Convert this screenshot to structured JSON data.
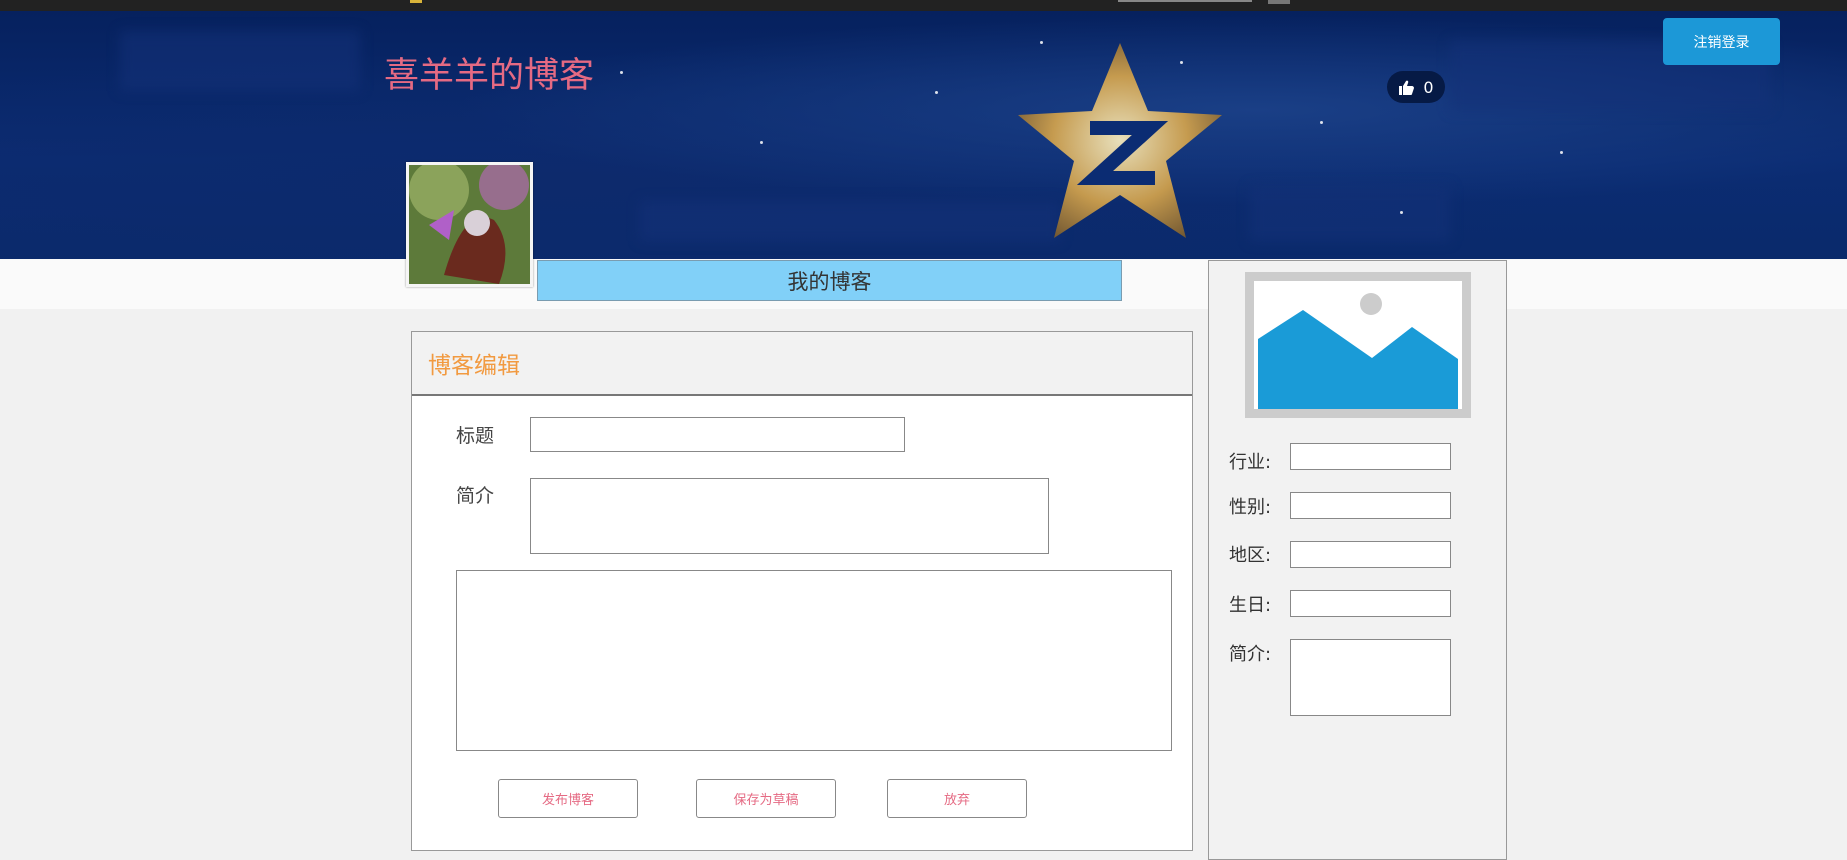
{
  "header": {
    "site_title": "喜羊羊的博客",
    "logout_label": "注销登录",
    "like_count": "0",
    "like_icon": "thumbs-up-icon",
    "my_blog_tab": "我的博客"
  },
  "editor": {
    "heading": "博客编辑",
    "title_label": "标题",
    "title_value": "",
    "summary_label": "简介",
    "summary_value": "",
    "content_value": "",
    "buttons": {
      "publish": "发布博客",
      "save_draft": "保存为草稿",
      "discard": "放弃"
    }
  },
  "profile": {
    "image_icon": "image-placeholder-icon",
    "industry_label": "行业:",
    "industry_value": "",
    "gender_label": "性别:",
    "gender_value": "",
    "region_label": "地区:",
    "region_value": "",
    "birthday_label": "生日:",
    "birthday_value": "",
    "bio_label": "简介:",
    "bio_value": ""
  },
  "colors": {
    "title_pink": "#e56a83",
    "button_blue": "#1c98d7",
    "tab_blue": "#81d0f8",
    "heading_orange": "#f29a40",
    "placeholder_blue": "#1a9bd7"
  }
}
